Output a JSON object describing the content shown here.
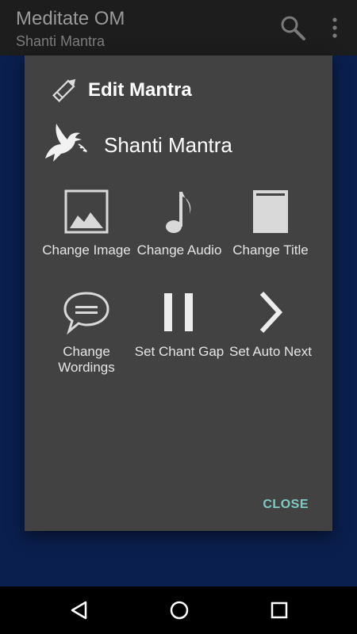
{
  "app_bar": {
    "title": "Meditate OM",
    "subtitle": "Shanti Mantra",
    "search_icon": "search-icon",
    "menu_icon": "overflow-menu-icon"
  },
  "dialog": {
    "header_label": "Edit Mantra",
    "mantra_name": "Shanti Mantra",
    "actions": [
      {
        "label": "Change Image",
        "icon": "image-icon"
      },
      {
        "label": "Change Audio",
        "icon": "music-note-icon"
      },
      {
        "label": "Change Title",
        "icon": "title-icon"
      },
      {
        "label": "Change Wordings",
        "icon": "chat-bubble-icon"
      },
      {
        "label": "Set Chant Gap",
        "icon": "pause-icon"
      },
      {
        "label": "Set Auto Next",
        "icon": "chevron-right-icon"
      }
    ],
    "close_label": "CLOSE",
    "accent_color": "#80cbc4"
  },
  "navbar": {
    "back_icon": "back-icon",
    "home_icon": "home-icon",
    "recent_icon": "recent-apps-icon"
  }
}
